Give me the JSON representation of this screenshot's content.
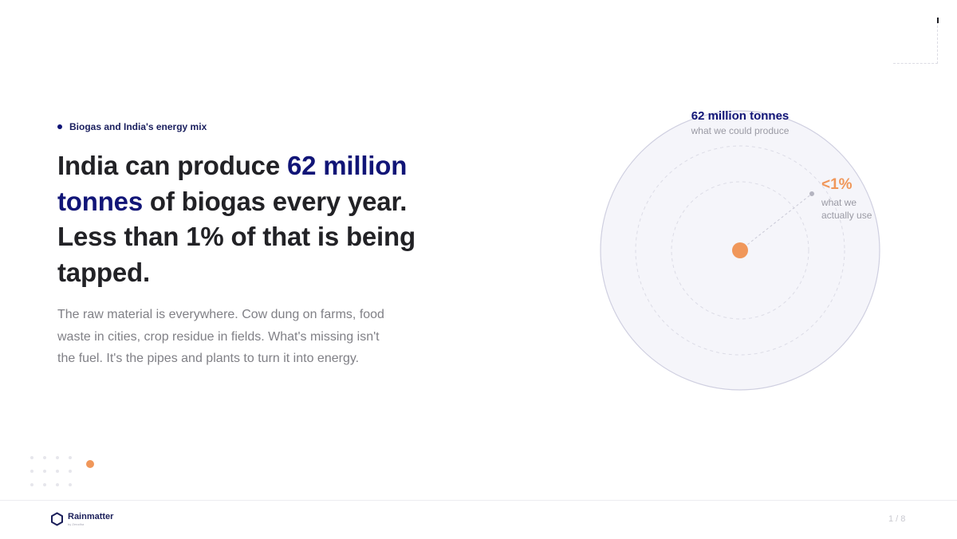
{
  "eyebrow": "Biogas and India's energy mix",
  "headline": {
    "part1": "India can produce ",
    "highlight": "62 million tonnes",
    "part2": " of biogas every year. Less than 1% of that is being tapped."
  },
  "body": "The raw material is everywhere. Cow dung on farms, food waste in cities, crop residue in fields. What's missing isn't the fuel. It's the pipes and plants to turn it into energy.",
  "diagram": {
    "total_value": "62 million tonnes",
    "total_caption": "what we could produce",
    "used_value": "<1%",
    "used_caption_line1": "what we",
    "used_caption_line2": "actually use",
    "used_fraction_max": 0.01
  },
  "footer": {
    "logo_name": "Rainmatter",
    "logo_sub": "by Zerodha",
    "page": "1 / 8"
  },
  "colors": {
    "accent_navy": "#111577",
    "accent_orange": "#f0975a",
    "circle_fill": "#f5f5fa",
    "circle_stroke": "#cfcfe0"
  }
}
